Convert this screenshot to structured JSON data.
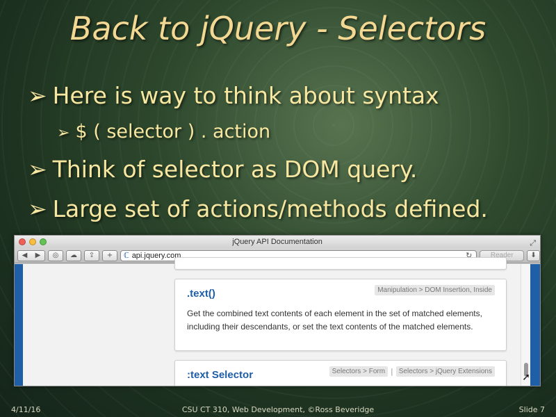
{
  "slide": {
    "title": "Back to jQuery - Selectors",
    "bullets": [
      {
        "text": "Here is way to think about syntax",
        "level": 1
      },
      {
        "text": "$ ( selector ) . action",
        "level": 2
      },
      {
        "text": "Think of selector as DOM query.",
        "level": 1
      },
      {
        "text": "Large set of actions/methods defined.",
        "level": 1
      }
    ],
    "bullet_icon": "arrow-bullet-icon"
  },
  "browser": {
    "window_title": "jQuery API Documentation",
    "url": "api.jquery.com",
    "reader_label": "Reader",
    "entries": [
      {
        "title": ".text()",
        "categories": [
          "Manipulation > DOM Insertion, Inside"
        ],
        "description": "Get the combined text contents of each element in the set of matched elements, including their descendants, or set the text contents of the matched elements."
      },
      {
        "title": ":text Selector",
        "categories": [
          "Selectors > Form",
          "Selectors > jQuery Extensions"
        ],
        "separator": "|"
      }
    ]
  },
  "footer": {
    "date": "4/11/16",
    "center": "CSU CT 310, Web Development, ©Ross Beveridge",
    "slide_number": "Slide 7"
  }
}
